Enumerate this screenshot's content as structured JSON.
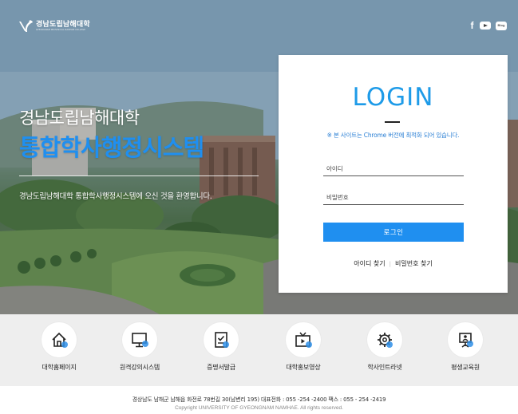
{
  "brand": {
    "name": "경남도립남해대학",
    "subtitle": "GYEONGNAM PROVINCIAL NAMHAE COLLEGE"
  },
  "social": {
    "facebook": "f",
    "blog": "Blog"
  },
  "hero": {
    "title": "경남도립남해대학",
    "system": "통합학사행정시스템",
    "welcome": "경남도립남해대학 통합학사행정시스템에 오신 것을 환영합니다."
  },
  "login": {
    "heading": "LOGIN",
    "notice": "※ 본 사이트는 Chrome 버전에 최적화 되어 있습니다.",
    "id_placeholder": "아이디",
    "pw_placeholder": "비밀번호",
    "button": "로그인",
    "find_id": "아이디 찾기",
    "find_pw": "비밀번호 찾기"
  },
  "quick_links": [
    {
      "label": "대학홈페이지",
      "icon": "home-icon"
    },
    {
      "label": "원격강의시스템",
      "icon": "monitor-icon"
    },
    {
      "label": "증명서발급",
      "icon": "certificate-icon"
    },
    {
      "label": "대학홍보영상",
      "icon": "tv-icon"
    },
    {
      "label": "학사인트라넷",
      "icon": "gear-icon"
    },
    {
      "label": "평생교육원",
      "icon": "lecture-icon"
    }
  ],
  "footer": {
    "address": "경상남도 남해군 남해읍 화전로 78번길 30(남변리 195) 대표전화 : 055 -254 -2400 팩스 : 055 - 254 -2419",
    "copyright": "Copyright UNIVERSITY OF GYEONGNAM NAMHAE. All rights reserved."
  },
  "colors": {
    "accent": "#1f8ff0",
    "login_heading": "#1e9be8",
    "quick_band": "#eeeeee"
  }
}
